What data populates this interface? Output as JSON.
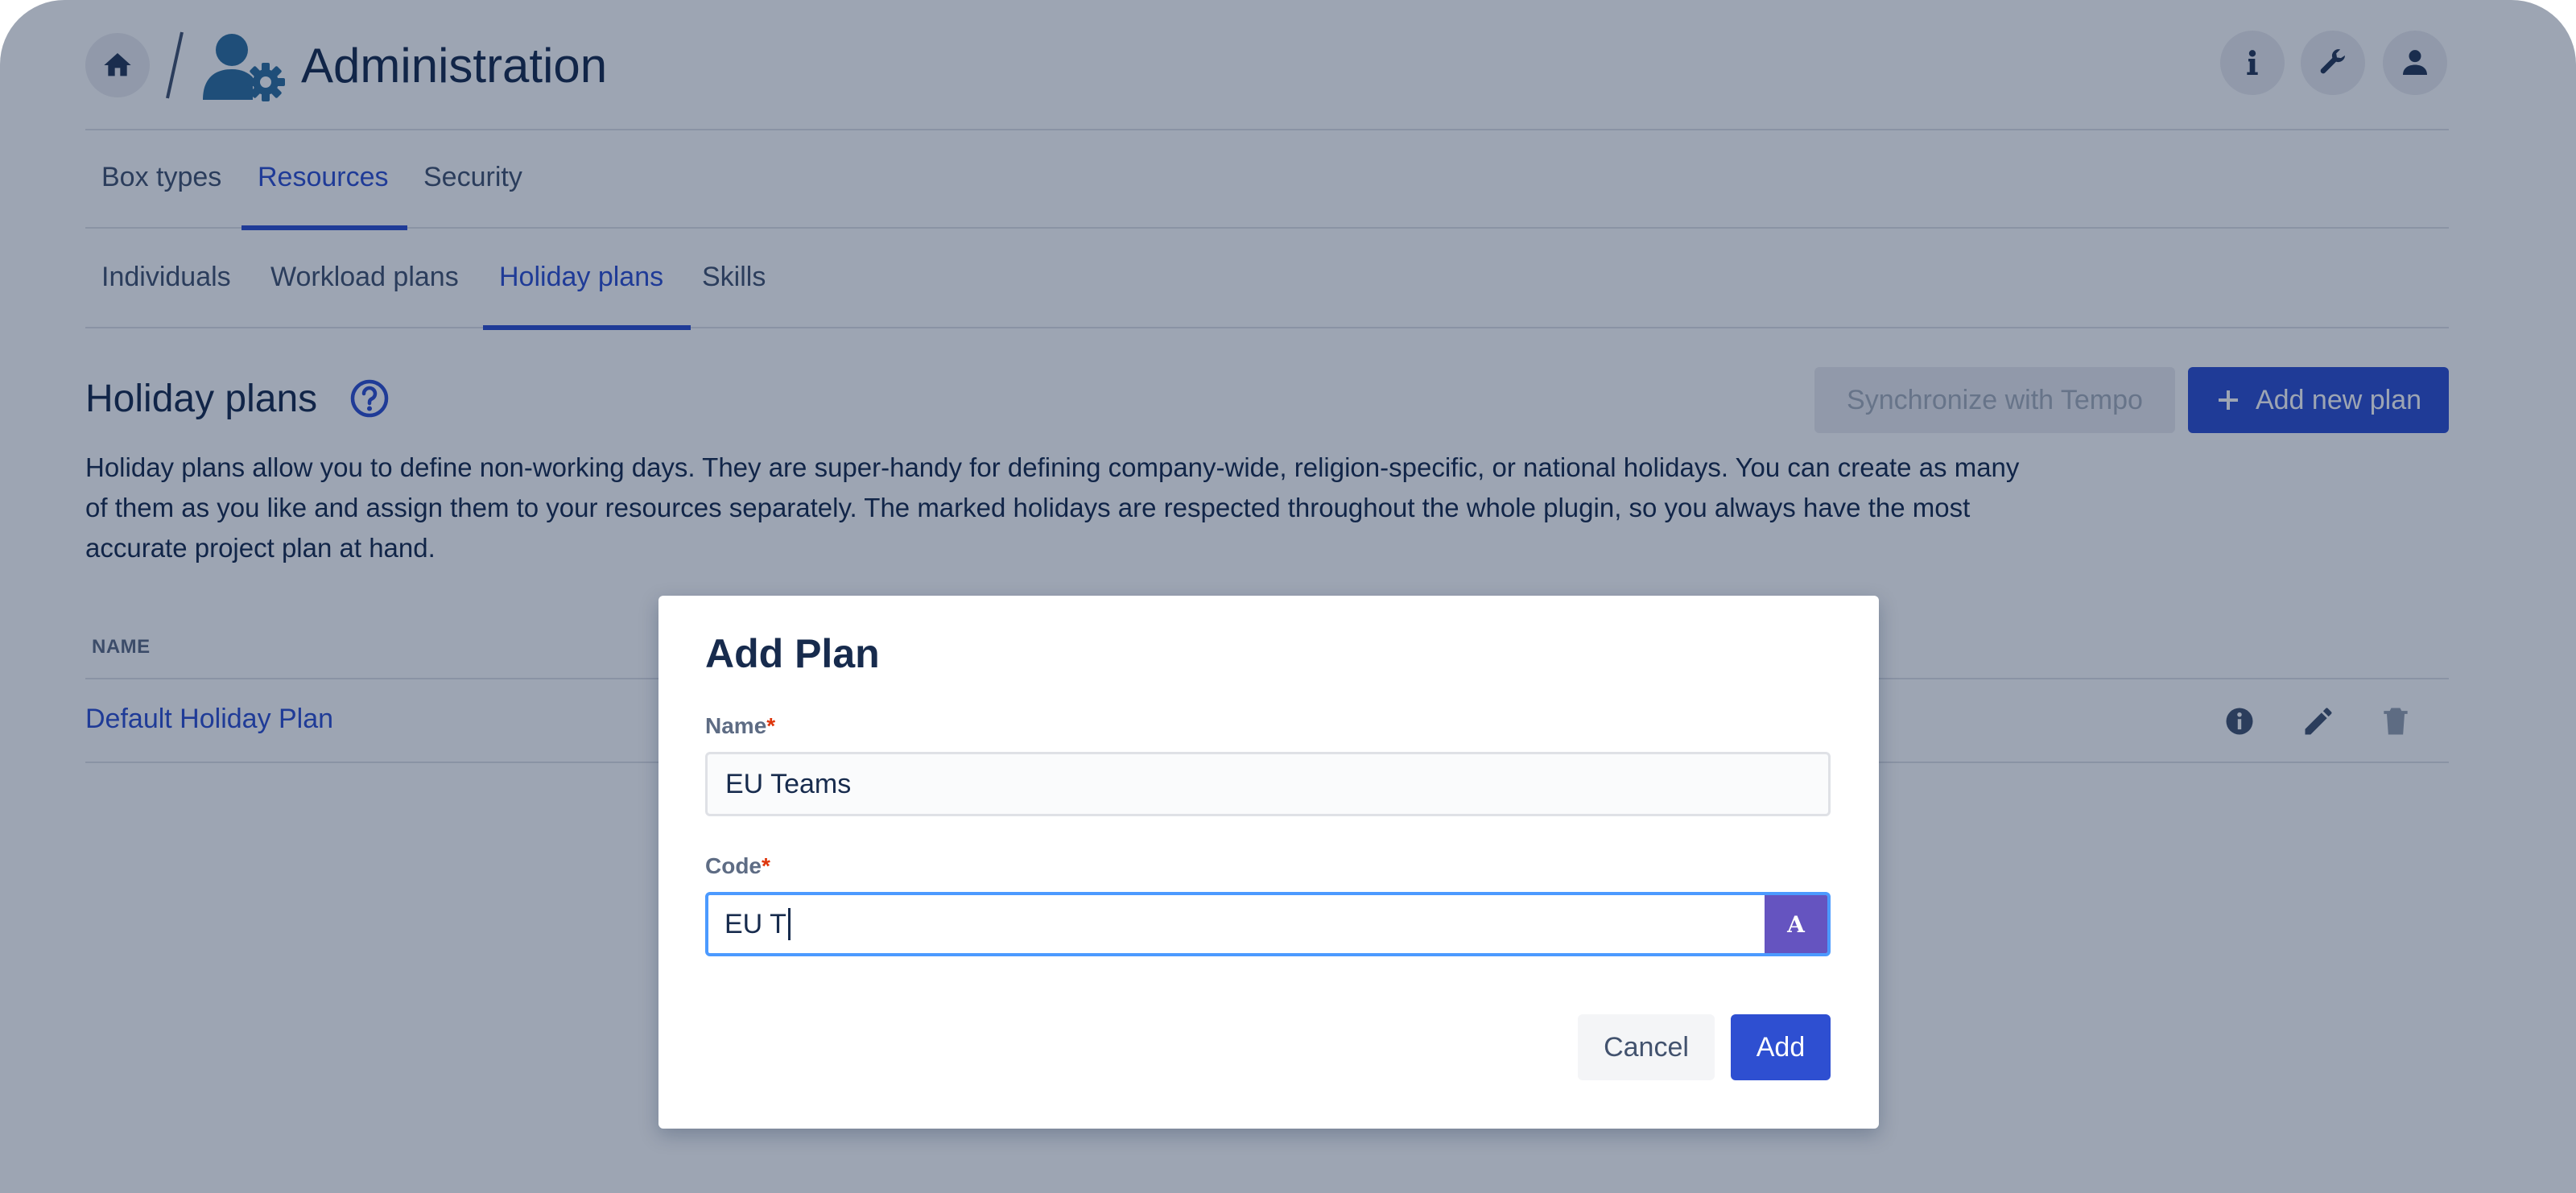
{
  "header": {
    "title": "Administration",
    "icons": {
      "home": "home-icon",
      "admin": "user-gear-icon",
      "info": "info-icon",
      "tools": "wrench-icon",
      "user": "user-icon"
    }
  },
  "tabs_primary": [
    {
      "label": "Box types",
      "active": false
    },
    {
      "label": "Resources",
      "active": true
    },
    {
      "label": "Security",
      "active": false
    }
  ],
  "tabs_secondary": [
    {
      "label": "Individuals",
      "active": false
    },
    {
      "label": "Workload plans",
      "active": false
    },
    {
      "label": "Holiday plans",
      "active": true
    },
    {
      "label": "Skills",
      "active": false
    }
  ],
  "section": {
    "title": "Holiday plans",
    "sync_button": "Synchronize with Tempo",
    "add_button": "Add new plan",
    "description": "Holiday plans allow you to define non-working days. They are super-handy for defining company-wide, religion-specific, or national holidays. You can create as many of them as you like and assign them to your resources separately. The marked holidays are respected throughout the whole plugin, so you always have the most accurate project plan at hand."
  },
  "table": {
    "columns": [
      "NAME"
    ],
    "rows": [
      {
        "name": "Default Holiday Plan"
      }
    ]
  },
  "modal": {
    "title": "Add Plan",
    "name_label": "Name",
    "name_value": "EU Teams",
    "code_label": "Code",
    "code_value": "EU T",
    "code_addon": "A",
    "required_mark": "*",
    "cancel_label": "Cancel",
    "add_label": "Add"
  },
  "colors": {
    "accent": "#2e4fd1",
    "addon": "#6554c0",
    "focus": "#4c9aff",
    "required": "#de350b"
  }
}
